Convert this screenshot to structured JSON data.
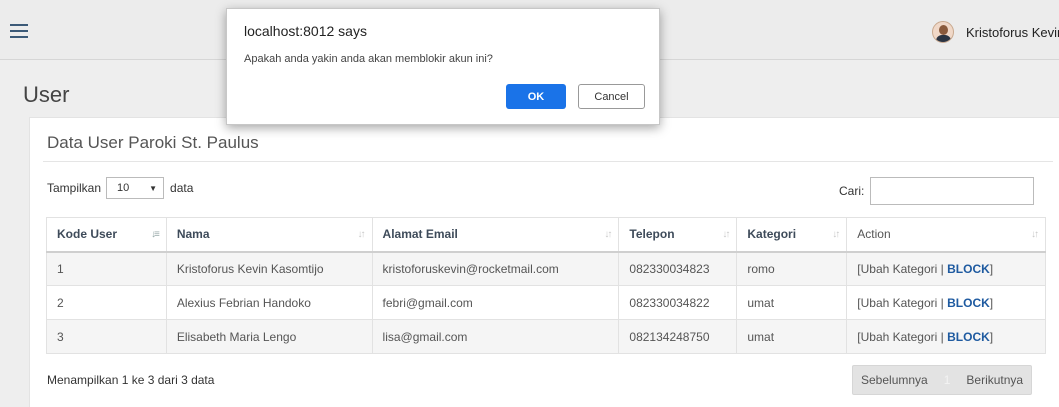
{
  "header": {
    "menu_icon": "hamburger-icon",
    "user_name": "Kristoforus Kevin",
    "avatar_icon": "user-avatar"
  },
  "page": {
    "title": "User"
  },
  "panel": {
    "title": "Data User Paroki St. Paulus",
    "length": {
      "prefix": "Tampilkan",
      "value": "10",
      "suffix": "data"
    },
    "search": {
      "label": "Cari:",
      "value": ""
    },
    "columns": [
      "Kode User",
      "Nama",
      "Alamat Email",
      "Telepon",
      "Kategori",
      "Action"
    ],
    "rows": [
      {
        "kode": "1",
        "nama": "Kristoforus Kevin Kasomtijo",
        "email": "kristoforuskevin@rocketmail.com",
        "telepon": "082330034823",
        "kategori": "romo",
        "ubah": "[Ubah Kategori | ",
        "block": "BLOCK",
        "close": "]"
      },
      {
        "kode": "2",
        "nama": "Alexius Febrian Handoko",
        "email": "febri@gmail.com",
        "telepon": "082330034822",
        "kategori": "umat",
        "ubah": "[Ubah Kategori | ",
        "block": "BLOCK",
        "close": "]"
      },
      {
        "kode": "3",
        "nama": "Elisabeth Maria Lengo",
        "email": "lisa@gmail.com",
        "telepon": "082134248750",
        "kategori": "umat",
        "ubah": "[Ubah Kategori | ",
        "block": "BLOCK",
        "close": "]"
      }
    ],
    "info": "Menampilkan 1 ke 3 dari 3 data",
    "pager": {
      "prev": "Sebelumnya",
      "current": "1",
      "next": "Berikutnya"
    }
  },
  "dialog": {
    "title": "localhost:8012 says",
    "message": "Apakah anda yakin anda akan memblokir akun ini?",
    "ok_label": "OK",
    "cancel_label": "Cancel"
  },
  "colors": {
    "accent": "#1a73e8",
    "link": "#1e5aa0",
    "topbar": "#ececec"
  }
}
